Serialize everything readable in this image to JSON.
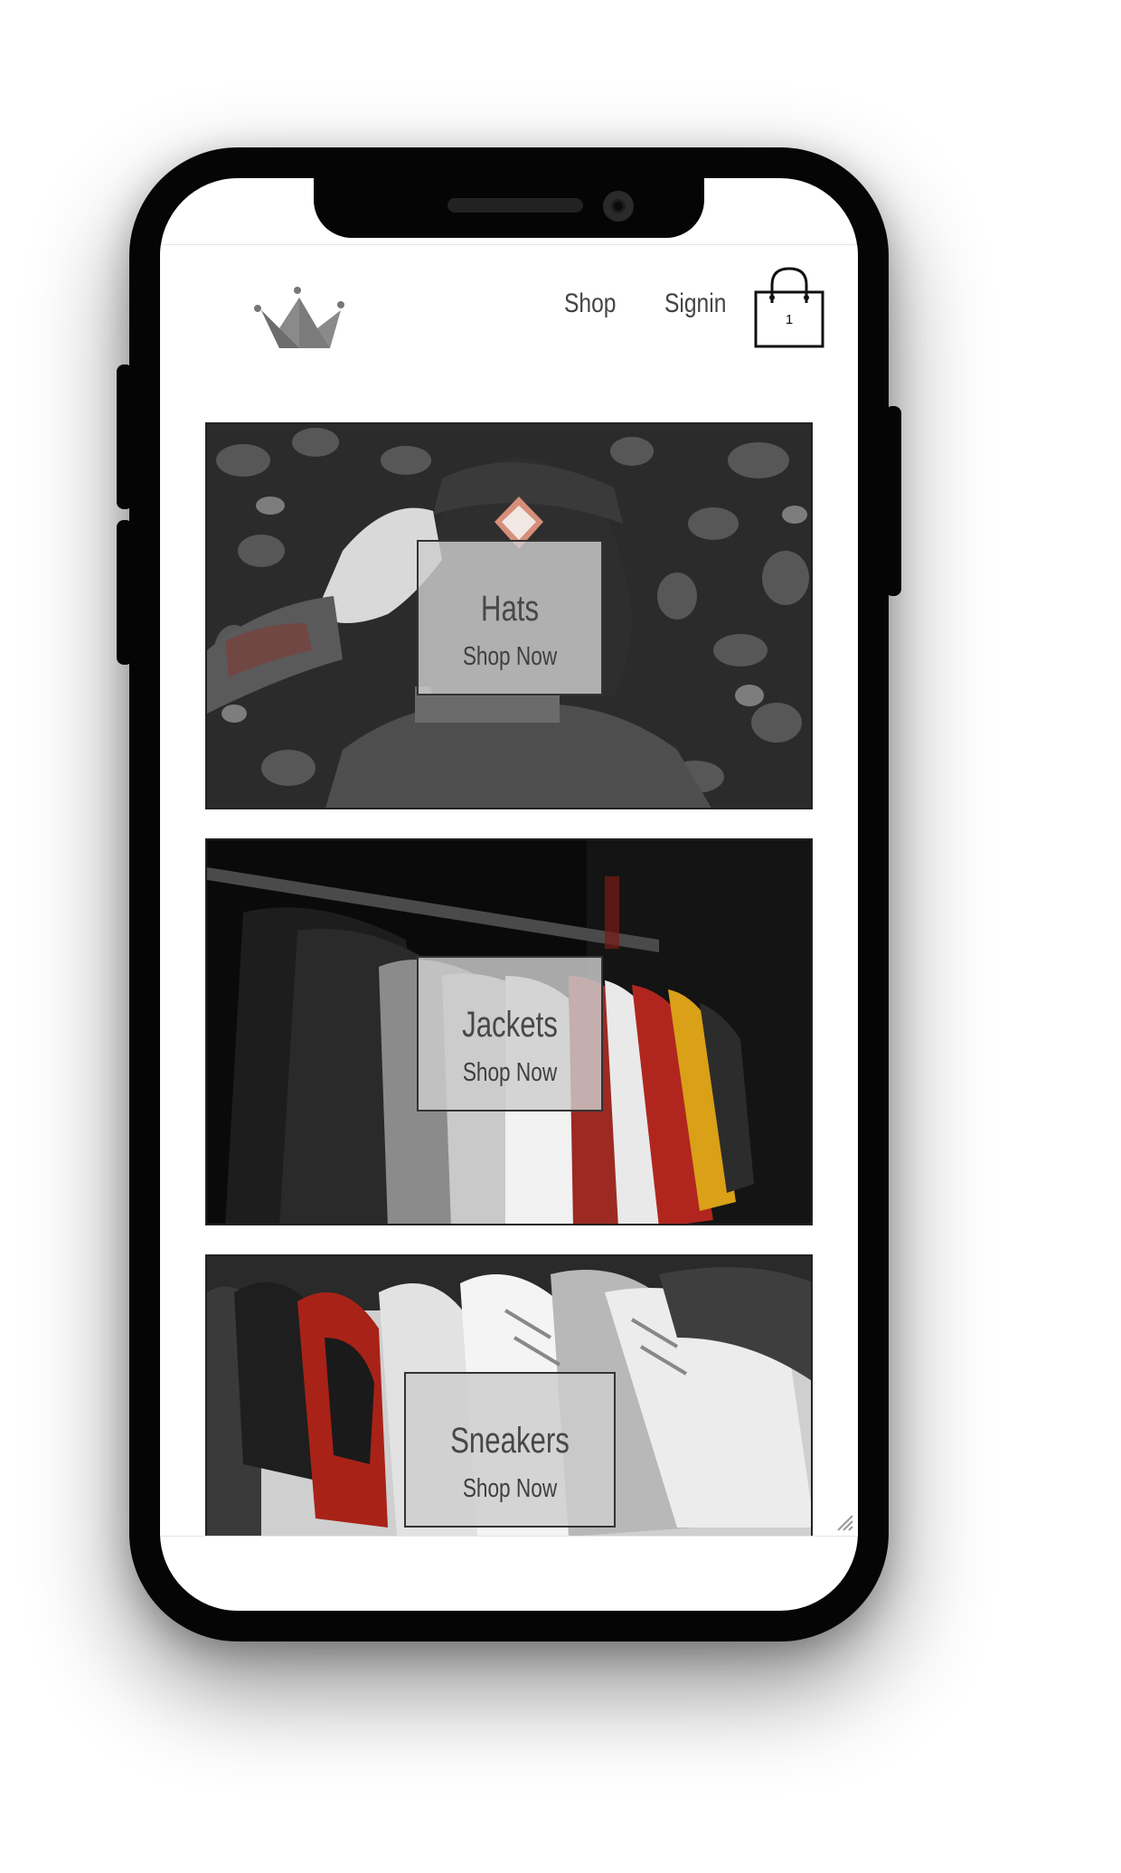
{
  "nav": {
    "logo_icon": "crown-icon",
    "shop_label": "Shop",
    "signin_label": "Signin",
    "cart_icon": "shopping-bag-icon",
    "cart_count": "1"
  },
  "categories": [
    {
      "title": "Hats",
      "cta": "Shop Now"
    },
    {
      "title": "Jackets",
      "cta": "Shop Now"
    },
    {
      "title": "Sneakers",
      "cta": "Shop Now"
    }
  ],
  "colors": {
    "accent_red": "#b0261e",
    "accent_yellow": "#d9a018",
    "overlay": "#cdcdcd",
    "text": "#444444"
  }
}
